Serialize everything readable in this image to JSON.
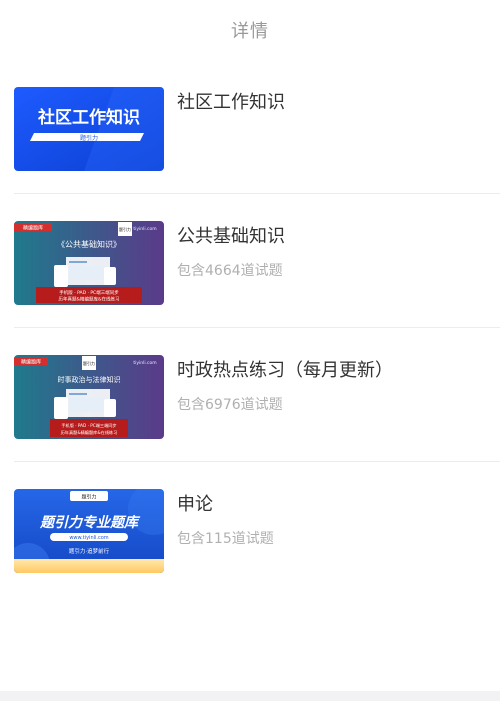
{
  "header": {
    "title": "详情"
  },
  "items": [
    {
      "title": "社区工作知识",
      "count": "",
      "thumb": {
        "main_text": "社区工作知识",
        "sub_text": "题引力"
      }
    },
    {
      "title": "公共基础知识",
      "count": "包含4664道试题",
      "thumb": {
        "badge": "精编题库",
        "logo": "题引力",
        "site": "tiyinli.com",
        "main_text": "《公共基础知识》",
        "line1": "手机版 · PAD · PC端三端同步",
        "line2": "历年真题&精编题库&在线练习"
      }
    },
    {
      "title": "时政热点练习（每月更新）",
      "count": "包含6976道试题",
      "thumb": {
        "badge": "精编题库",
        "logo": "题引力",
        "site": "tiyinli.com",
        "main_text": "时事政治与法律知识",
        "line1": "手机版 · PAD · PC端三端同步",
        "line2": "历年真题&精编题库&在线练习"
      }
    },
    {
      "title": "申论",
      "count": "包含115道试题",
      "thumb": {
        "logo": "题引力",
        "main_text": "题引力专业题库",
        "site": "www.tiyinli.com",
        "footer": "题引力·追梦前行"
      }
    }
  ],
  "colors": {
    "blue": "#1a56e0",
    "teal": "#1f7a8c",
    "purple": "#5b3a8a",
    "red": "#b71c1c",
    "yellow": "#ffd54f"
  }
}
